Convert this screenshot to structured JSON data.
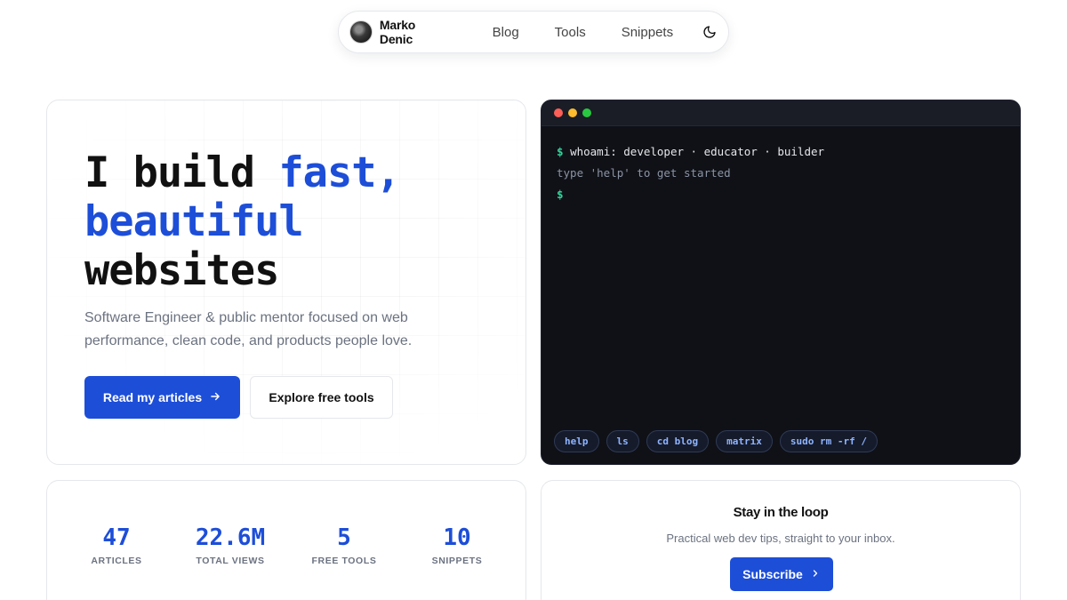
{
  "nav": {
    "brand": "Marko Denic",
    "links": [
      "Blog",
      "Tools",
      "Snippets"
    ],
    "theme_icon": "moon-icon"
  },
  "hero": {
    "headline_line1_plain": "I build ",
    "headline_line1_accent": "fast,",
    "headline_line2_accent": "beautiful",
    "headline_line3_plain": "websites",
    "subtitle": "Software Engineer & public mentor focused on web performance, clean code, and products people love.",
    "primary_button": "Read my articles",
    "primary_button_icon": "arrow-right-icon",
    "secondary_button": "Explore free tools",
    "accent_color": "#1d4ed8"
  },
  "terminal": {
    "prompt": "$",
    "line1": "whoami: developer · educator · builder",
    "line2": "type 'help' to get started",
    "chips": [
      "help",
      "ls",
      "cd blog",
      "matrix",
      "sudo rm -rf /"
    ],
    "dot_colors": [
      "#ff5f57",
      "#febc2e",
      "#28c840"
    ]
  },
  "stats": [
    {
      "value": "47",
      "label": "ARTICLES"
    },
    {
      "value": "22.6M",
      "label": "TOTAL VIEWS"
    },
    {
      "value": "5",
      "label": "FREE TOOLS"
    },
    {
      "value": "10",
      "label": "SNIPPETS"
    }
  ],
  "newsletter": {
    "title": "Stay in the loop",
    "description": "Practical web dev tips, straight to your inbox.",
    "button": "Subscribe",
    "button_icon": "chevron-right-icon"
  }
}
